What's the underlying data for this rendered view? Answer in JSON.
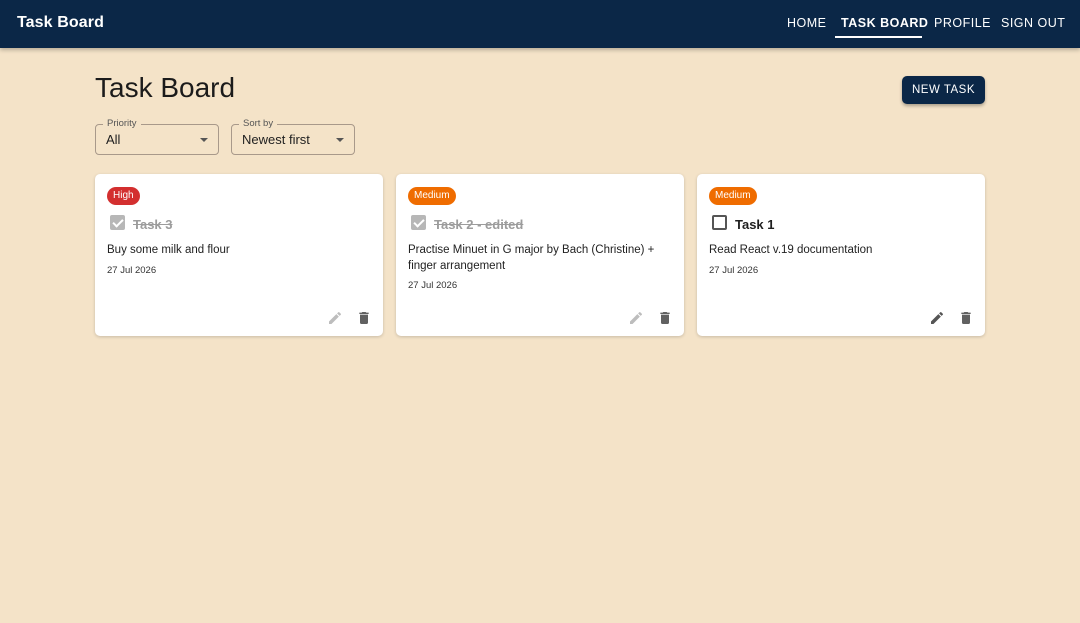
{
  "app": {
    "title": "Task Board"
  },
  "nav": {
    "home": "HOME",
    "task_board": "TASK BOARD",
    "profile": "PROFILE",
    "sign_out": "SIGN OUT"
  },
  "page": {
    "title": "Task Board",
    "new_task_label": "NEW TASK"
  },
  "filters": {
    "priority": {
      "label": "Priority",
      "value": "All"
    },
    "sort": {
      "label": "Sort by",
      "value": "Newest first"
    }
  },
  "colors": {
    "appbar": "#0b2747",
    "background": "#f4e3c8",
    "high": "#d32f2f",
    "medium": "#ef6c00"
  },
  "tasks": [
    {
      "priority": "High",
      "title": "Task 3",
      "completed": true,
      "description": "Buy some milk and flour",
      "date": "27 Jul 2026",
      "icons": [
        "pencil-icon",
        "trash-icon"
      ]
    },
    {
      "priority": "Medium",
      "title": "Task 2 - edited",
      "completed": true,
      "description": "Practise Minuet in G major by Bach (Christine) + finger arrangement",
      "date": "27 Jul 2026",
      "icons": [
        "pencil-icon",
        "trash-icon"
      ]
    },
    {
      "priority": "Medium",
      "title": "Task 1",
      "completed": false,
      "description": "Read React v.19 documentation",
      "date": "27 Jul 2026",
      "icons": [
        "pencil-icon",
        "trash-icon"
      ]
    }
  ]
}
